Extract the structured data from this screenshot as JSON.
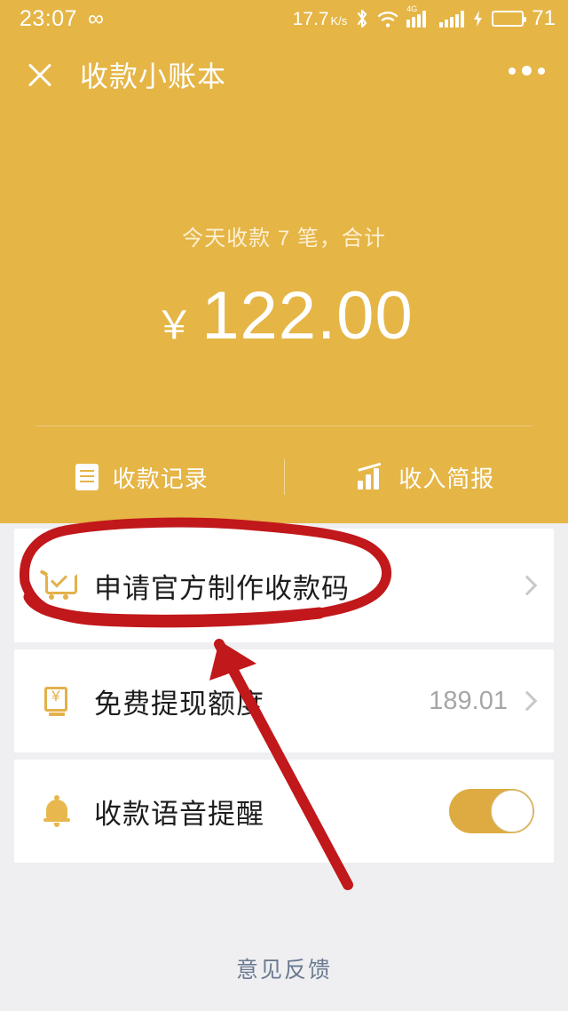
{
  "status_bar": {
    "time": "23:07",
    "infinity_icon": "infinity-icon",
    "net_speed": "17.7",
    "net_speed_unit": "K/s",
    "bluetooth_icon": "bluetooth-icon",
    "wifi_icon": "wifi-icon",
    "signal_label": "4G",
    "battery_percent": "71",
    "charging_icon": "charging-bolt-icon",
    "battery_color": "#27d70a"
  },
  "nav": {
    "close_icon": "close-icon",
    "title": "收款小账本",
    "more_icon": "more-options-icon"
  },
  "summary": {
    "subtitle": "今天收款 7 笔，合计",
    "currency_symbol": "￥",
    "amount": "122.00"
  },
  "tabs": [
    {
      "label": "收款记录",
      "icon": "record-document-icon"
    },
    {
      "label": "收入简报",
      "icon": "bar-chart-icon"
    }
  ],
  "rows": [
    {
      "id": "apply-qr",
      "icon": "shopping-cart-icon",
      "label": "申请官方制作收款码",
      "value": "",
      "accessory": "chevron-right-icon"
    },
    {
      "id": "free-withdraw",
      "icon": "atm-yen-icon",
      "label": "免费提现额度",
      "value": "189.01",
      "accessory": "chevron-right-icon"
    },
    {
      "id": "voice-alert",
      "icon": "bell-icon",
      "label": "收款语音提醒",
      "value": "",
      "accessory": "toggle-switch-on"
    }
  ],
  "footer": {
    "feedback_label": "意见反馈"
  },
  "theme": {
    "gold": "#e5b546",
    "page_bg": "#efeff1",
    "card_bg": "#ffffff",
    "annotation_red": "#c1181b",
    "toggle_on": "#ddab41",
    "icon_gold": "#e3b14a"
  },
  "annotation": {
    "ellipse_target": "申请官方制作收款码",
    "arrow_points_to": "申请官方制作收款码"
  }
}
